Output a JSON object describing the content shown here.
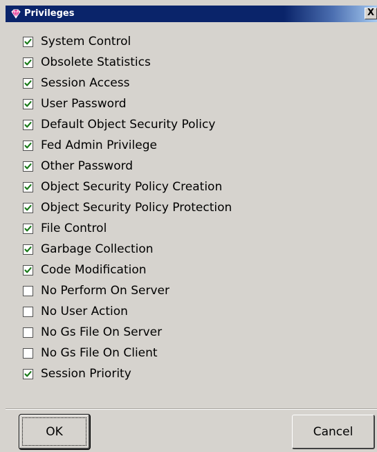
{
  "window": {
    "title": "Privileges",
    "close_label": "X"
  },
  "privileges": [
    {
      "label": "System Control",
      "checked": true
    },
    {
      "label": "Obsolete Statistics",
      "checked": true
    },
    {
      "label": "Session Access",
      "checked": true
    },
    {
      "label": "User Password",
      "checked": true
    },
    {
      "label": "Default Object Security Policy",
      "checked": true
    },
    {
      "label": "Fed Admin Privilege",
      "checked": true
    },
    {
      "label": "Other Password",
      "checked": true
    },
    {
      "label": "Object Security Policy Creation",
      "checked": true
    },
    {
      "label": "Object Security Policy Protection",
      "checked": true
    },
    {
      "label": "File Control",
      "checked": true
    },
    {
      "label": "Garbage Collection",
      "checked": true
    },
    {
      "label": "Code Modification",
      "checked": true
    },
    {
      "label": "No Perform On Server",
      "checked": false
    },
    {
      "label": "No User Action",
      "checked": false
    },
    {
      "label": "No Gs File On Server",
      "checked": false
    },
    {
      "label": "No Gs File On Client",
      "checked": false
    },
    {
      "label": "Session Priority",
      "checked": true
    }
  ],
  "buttons": {
    "ok_label": "OK",
    "cancel_label": "Cancel"
  },
  "colors": {
    "titlebar": "#0a246a",
    "checkmark": "#1a7a1a",
    "window_bg": "#d6d3ce"
  },
  "icons": {
    "title": "diamond-app-icon",
    "check": "checkmark-icon"
  }
}
